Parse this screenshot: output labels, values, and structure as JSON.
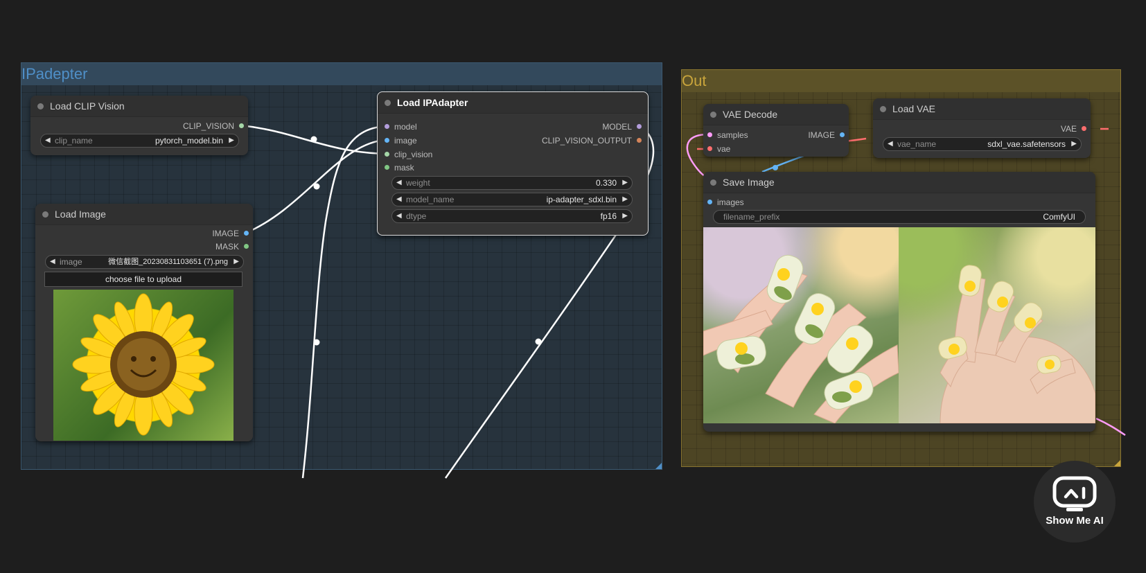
{
  "groups": {
    "ipadapter": {
      "title": "IPadepter"
    },
    "out": {
      "title": "Out"
    }
  },
  "nodes": {
    "load_clip_vision": {
      "title": "Load CLIP Vision",
      "outputs": [
        "CLIP_VISION"
      ],
      "widgets": [
        {
          "label": "clip_name",
          "value": "pytorch_model.bin"
        }
      ]
    },
    "load_image": {
      "title": "Load Image",
      "outputs": [
        "IMAGE",
        "MASK"
      ],
      "widgets": [
        {
          "label": "image",
          "value": "微信截图_20230831103651 (7).png"
        }
      ],
      "upload_button": "choose file to upload",
      "preview_icon": "sunflower-photo"
    },
    "load_ipadapter": {
      "title": "Load IPAdapter",
      "inputs": [
        "model",
        "image",
        "clip_vision",
        "mask"
      ],
      "outputs": [
        "MODEL",
        "CLIP_VISION_OUTPUT"
      ],
      "widgets": [
        {
          "label": "weight",
          "value": "0.330"
        },
        {
          "label": "model_name",
          "value": "ip-adapter_sdxl.bin"
        },
        {
          "label": "dtype",
          "value": "fp16"
        }
      ]
    },
    "vae_decode": {
      "title": "VAE Decode",
      "inputs": [
        "samples",
        "vae"
      ],
      "outputs": [
        "IMAGE"
      ]
    },
    "load_vae": {
      "title": "Load VAE",
      "outputs": [
        "VAE"
      ],
      "widgets": [
        {
          "label": "vae_name",
          "value": "sdxl_vae.safetensors"
        }
      ]
    },
    "save_image": {
      "title": "Save Image",
      "inputs": [
        "images"
      ],
      "widgets": [
        {
          "label": "filename_prefix",
          "value": "ComfyUI"
        }
      ],
      "preview_icons": [
        "nail-art-photo-1",
        "nail-art-photo-2"
      ]
    }
  },
  "colors": {
    "model_pin": "#b39ddb",
    "image_pin": "#64b5f6",
    "clip_pin": "#a5d6a7",
    "mask_pin": "#81c784",
    "output_pin": "#d4845a",
    "vae_pin": "#ff6e6e",
    "samples_pin": "#ff9cf9",
    "wire_white": "#ffffff",
    "wire_pink": "#ff9cf9",
    "wire_red": "#ff6e6e",
    "wire_blue": "#64b5f6"
  },
  "watermark": {
    "text": "Show Me AI",
    "icon": "robot-face-icon"
  }
}
